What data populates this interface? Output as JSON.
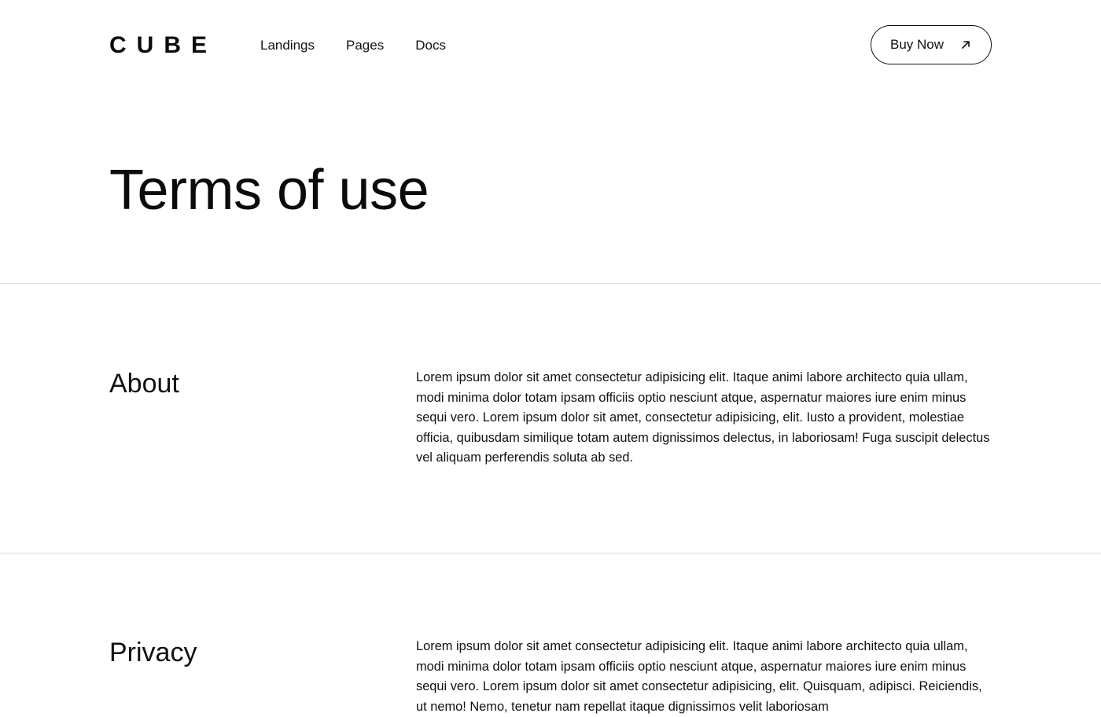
{
  "brand": {
    "logo": "CUBE"
  },
  "nav": {
    "items": [
      {
        "label": "Landings"
      },
      {
        "label": "Pages"
      },
      {
        "label": "Docs"
      }
    ]
  },
  "cta": {
    "label": "Buy Now",
    "icon": "arrow-up-right-icon"
  },
  "hero": {
    "title": "Terms of use"
  },
  "sections": [
    {
      "title": "About",
      "body": "Lorem ipsum dolor sit amet consectetur adipisicing elit. Itaque animi labore architecto quia ullam, modi minima dolor totam ipsam officiis optio nesciunt atque, aspernatur maiores iure enim minus sequi vero. Lorem ipsum dolor sit amet, consectetur adipisicing, elit. Iusto a provident, molestiae officia, quibusdam similique totam autem dignissimos delectus, in laboriosam! Fuga suscipit delectus vel aliquam perferendis soluta ab sed."
    },
    {
      "title": "Privacy",
      "body": "Lorem ipsum dolor sit amet consectetur adipisicing elit. Itaque animi labore architecto quia ullam, modi minima dolor totam ipsam officiis optio nesciunt atque, aspernatur maiores iure enim minus sequi vero. Lorem ipsum dolor sit amet consectetur adipisicing, elit. Quisquam, adipisci. Reiciendis, ut nemo! Nemo, tenetur nam repellat itaque dignissimos velit laboriosam"
    }
  ],
  "colors": {
    "text": "#111111",
    "divider": "#dedede",
    "background": "#ffffff"
  }
}
